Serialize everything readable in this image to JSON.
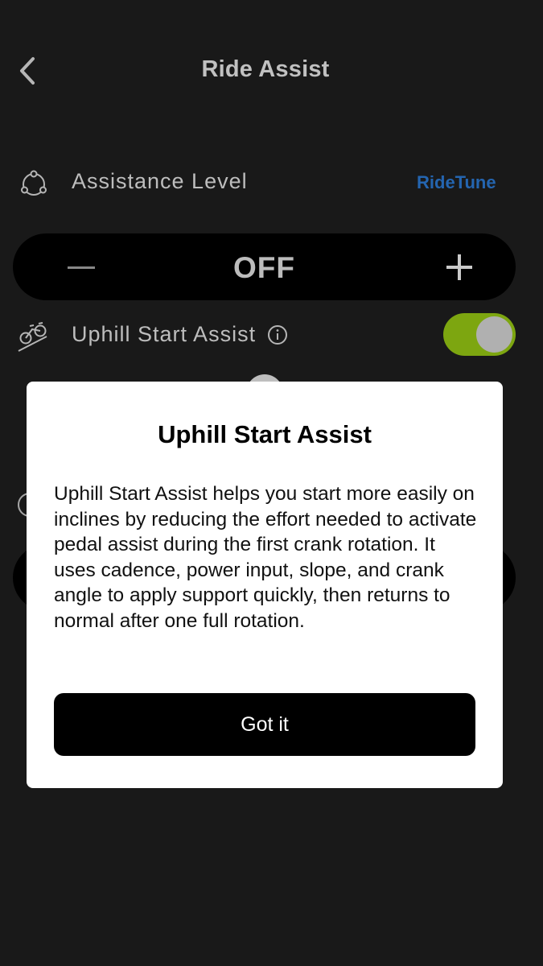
{
  "header": {
    "title": "Ride Assist",
    "back_icon": "chevron-left-icon"
  },
  "assistance": {
    "label": "Assistance Level",
    "icon": "assistance-icon",
    "link": "RideTune",
    "link_color": "#2a73c9"
  },
  "stepper": {
    "value": "OFF",
    "minus_icon": "minus-icon",
    "plus_icon": "plus-icon"
  },
  "uphill": {
    "label": "Uphill Start Assist",
    "icon": "uphill-bike-icon",
    "info_icon": "info-icon",
    "toggle_on": true,
    "toggle_color": "#8fbe13"
  },
  "modal": {
    "title": "Uphill Start Assist",
    "body": "Uphill Start Assist helps you start more easily on inclines by reducing the effort needed to activate pedal assist during the first crank rotation. It uses cadence, power input, slope, and crank angle to apply support quickly, then returns to normal after one full rotation.",
    "button": "Got it"
  }
}
